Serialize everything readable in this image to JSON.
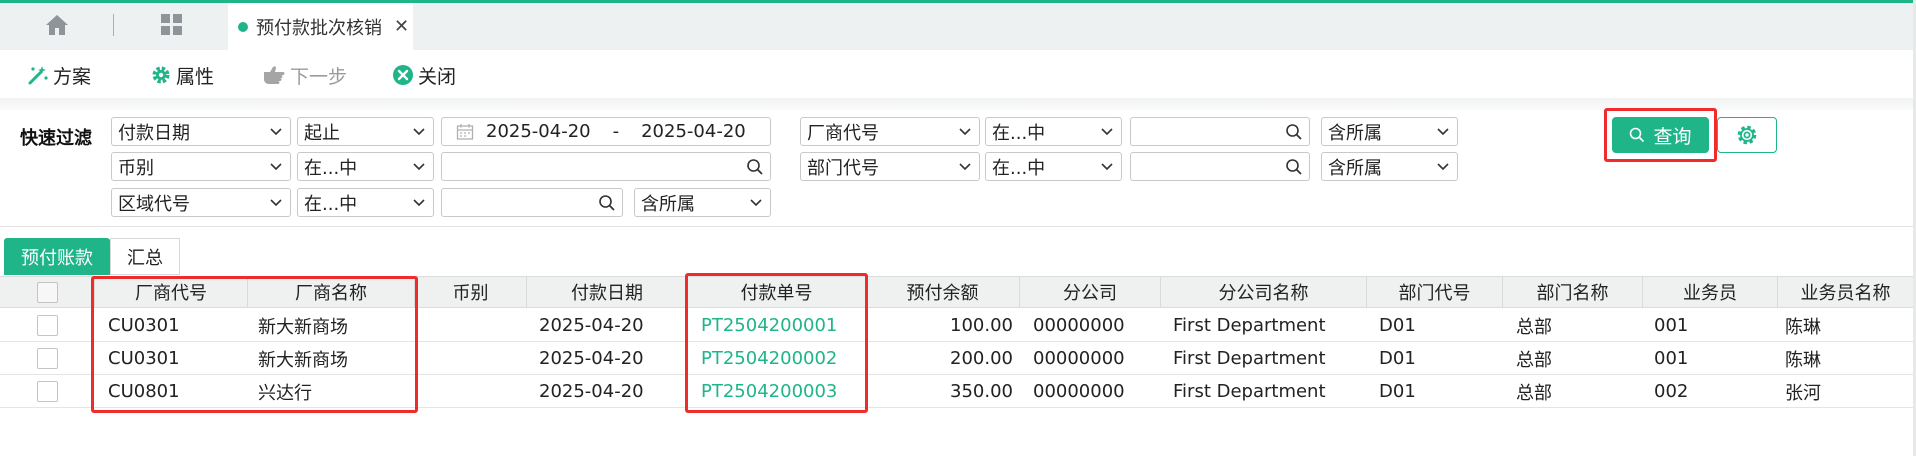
{
  "tabbar": {
    "active_tab": "预付款批次核销",
    "close_symbol": "✕",
    "accent": "#1fb589"
  },
  "toolbar": {
    "scheme": "方案",
    "properties": "属性",
    "next": "下一步",
    "close": "关闭"
  },
  "filter": {
    "label": "快速过滤",
    "row1": {
      "field": "付款日期",
      "op": "起止",
      "date_from": "2025-04-20",
      "date_sep": "-",
      "date_to": "2025-04-20"
    },
    "row2": {
      "field": "币别",
      "op": "在...中",
      "value": ""
    },
    "row3": {
      "field": "区域代号",
      "op": "在...中",
      "value": "",
      "scope": "含所属"
    },
    "right1": {
      "field": "厂商代号",
      "op": "在...中",
      "value": "",
      "scope": "含所属"
    },
    "right2": {
      "field": "部门代号",
      "op": "在...中",
      "value": "",
      "scope": "含所属"
    },
    "query_button": "查询"
  },
  "grid": {
    "tabs": [
      "预付账款",
      "汇总"
    ],
    "columns": [
      "厂商代号",
      "厂商名称",
      "币别",
      "付款日期",
      "付款单号",
      "预付余额",
      "分公司",
      "分公司名称",
      "部门代号",
      "部门名称",
      "业务员",
      "业务员名称"
    ],
    "rows": [
      [
        "CU0301",
        "新大新商场",
        "",
        "2025-04-20",
        "PT2504200001",
        "100.00",
        "00000000",
        "First Department",
        "D01",
        "总部",
        "001",
        "陈琳"
      ],
      [
        "CU0301",
        "新大新商场",
        "",
        "2025-04-20",
        "PT2504200002",
        "200.00",
        "00000000",
        "First Department",
        "D01",
        "总部",
        "001",
        "陈琳"
      ],
      [
        "CU0801",
        "兴达行",
        "",
        "2025-04-20",
        "PT2504200003",
        "350.00",
        "00000000",
        "First Department",
        "D01",
        "总部",
        "002",
        "张河"
      ]
    ]
  }
}
